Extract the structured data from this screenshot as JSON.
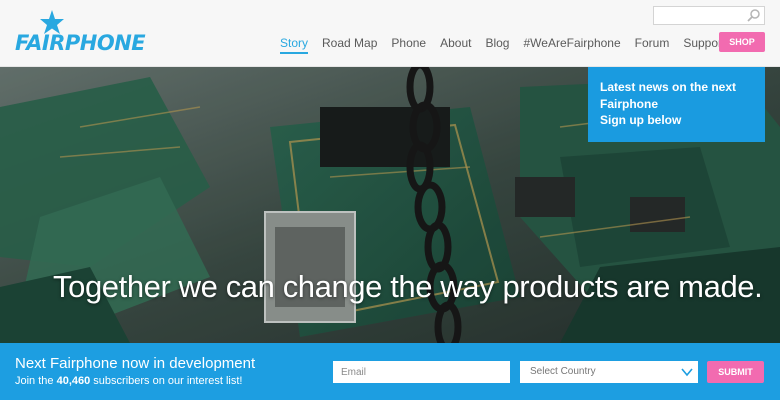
{
  "brand": {
    "name": "FAIRPHONE",
    "color": "#29a8e0"
  },
  "search": {
    "placeholder": ""
  },
  "nav": {
    "items": [
      {
        "label": "Story",
        "active": true
      },
      {
        "label": "Road Map"
      },
      {
        "label": "Phone"
      },
      {
        "label": "About"
      },
      {
        "label": "Blog"
      },
      {
        "label": "#WeAreFairphone"
      },
      {
        "label": "Forum"
      },
      {
        "label": "Support"
      }
    ]
  },
  "shop": {
    "label": "SHOP"
  },
  "hero": {
    "tagline": "Together we can change the way products are made.",
    "news": {
      "line1": "Latest news on the next",
      "line2": "Fairphone",
      "line3": "Sign up below"
    }
  },
  "signup": {
    "title": "Next Fairphone now in development",
    "subtitle_pre": "Join the ",
    "subscriber_count": "40,460",
    "subtitle_post": " subscribers on our interest list!",
    "email_placeholder": "Email",
    "country_placeholder": "Select Country",
    "submit_label": "SUBMIT"
  },
  "colors": {
    "accent": "#1d9ee1",
    "pink": "#f26bb0"
  }
}
